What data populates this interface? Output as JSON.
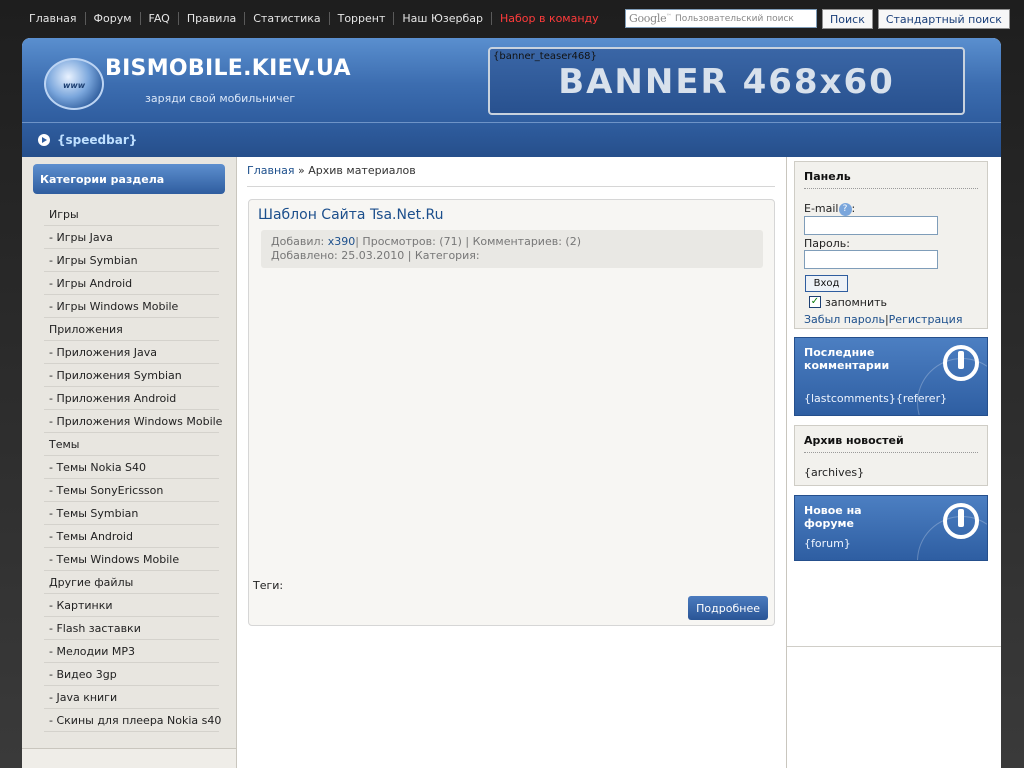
{
  "topnav": {
    "items": [
      "Главная",
      "Форум",
      "FAQ",
      "Правила",
      "Статистика",
      "Торрент",
      "Наш Юзербар",
      "Набор в команду"
    ]
  },
  "search": {
    "google_logo": "Google",
    "placeholder": "Пользовательский поиск",
    "search_button": "Поиск",
    "standard_button": "Стандартный поиск"
  },
  "header": {
    "logo_badge": "www",
    "site_name": "BISMOBILE.KIEV.UA",
    "slogan": "заряди свой мобильничег",
    "banner_teaser": "{banner_teaser468}",
    "banner_text": "BANNER 468x60",
    "speedbar": "{speedbar}"
  },
  "left": {
    "title": "Категории раздела",
    "items": [
      "Игры",
      "- Игры Java",
      "- Игры Symbian",
      "- Игры Android",
      "- Игры Windows Mobile",
      "Приложения",
      "- Приложения Java",
      "- Приложения Symbian",
      "- Приложения Android",
      "- Приложения Windows Mobile",
      "Темы",
      "- Темы Nokia S40",
      "- Темы SonyEricsson",
      "- Темы Symbian",
      "- Темы Android",
      "- Темы Windows Mobile",
      "Другие файлы",
      "- Картинки",
      "- Flash заставки",
      "- Мелодии MP3",
      "- Видео 3gp",
      "- Java книги",
      "- Скины для плеера Nokia s40"
    ]
  },
  "breadcrumb": {
    "home": "Главная",
    "sep": " » ",
    "current": "Архив материалов"
  },
  "post": {
    "title": "Шаблон Сайта Tsa.Net.Ru",
    "added_by_label": "Добавил: ",
    "author": "x390",
    "stats": "| Просмотров: (71) | Комментариев: (2)",
    "date_line": "Добавлено: 25.03.2010 | Категория:",
    "tags_label": "Теги:",
    "more_button": "Подробнее"
  },
  "panel": {
    "title": "Панель",
    "email_label": "E-mail",
    "email_colon": ":",
    "help_icon_glyph": "?",
    "password_label": "Пароль:",
    "login_button": "Вход",
    "remember_label": "запомнить",
    "checkbox_glyph": "✓",
    "forgot_link": "Забыл пароль",
    "link_sep": "|",
    "register_link": "Регистрация"
  },
  "last_comments": {
    "title": "Последние комментарии",
    "body": "{lastcomments}{referer}"
  },
  "archive": {
    "title": "Архив новостей",
    "body": "{archives}"
  },
  "forum": {
    "title": "Новое на форуме",
    "body": "{forum}"
  },
  "colors": {
    "accent_blue": "#2f5d9f",
    "link_blue": "#1c4f8c",
    "recruit_red": "#ff3b3b"
  }
}
